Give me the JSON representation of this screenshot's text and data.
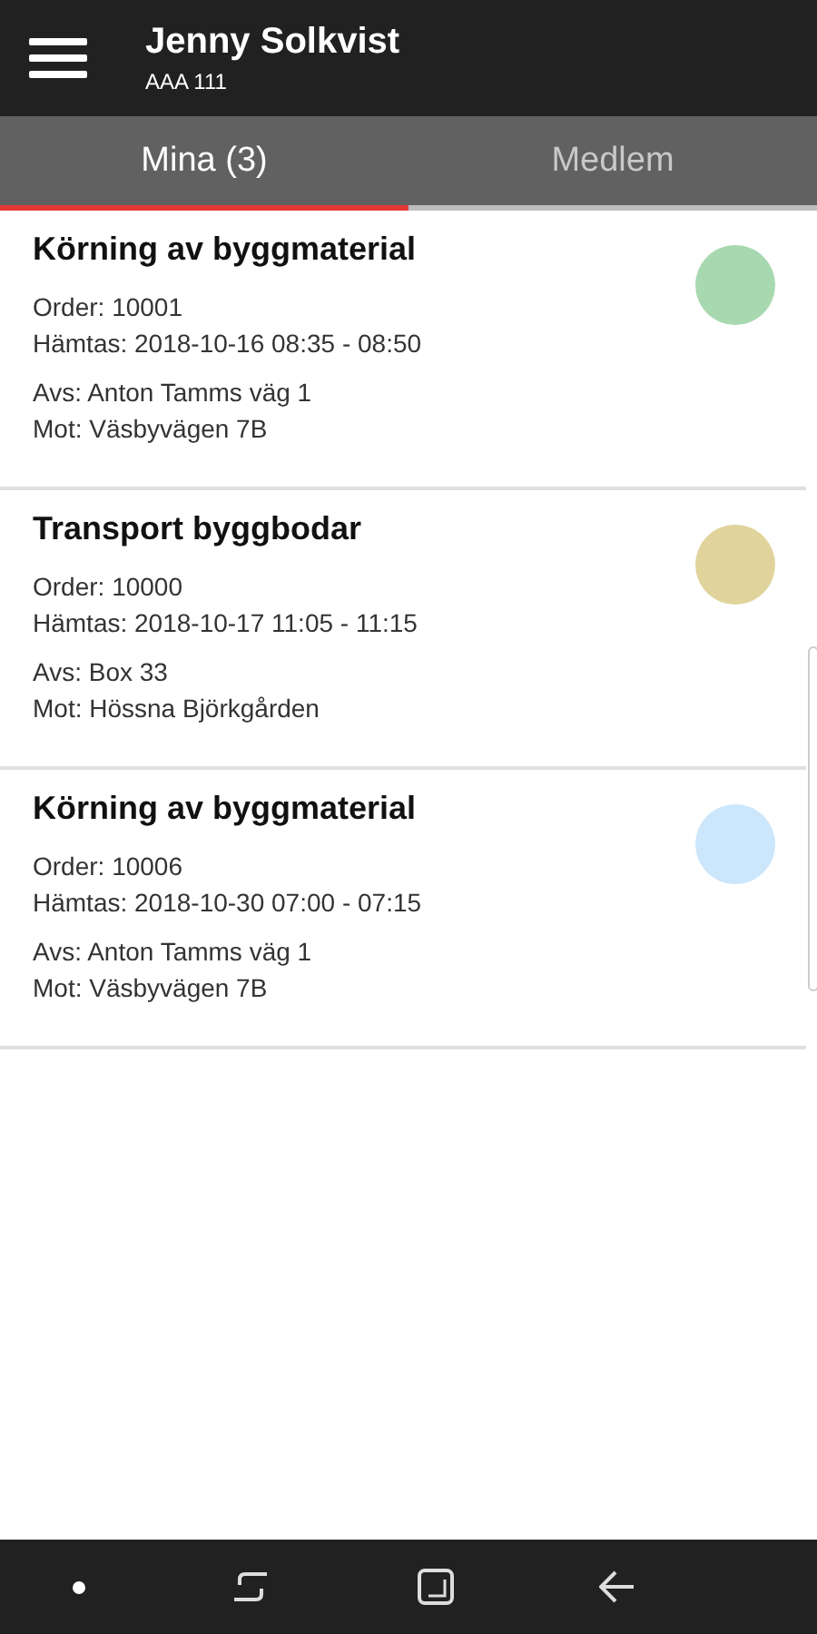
{
  "header": {
    "title": "Jenny Solkvist",
    "subtitle": "AAA 111"
  },
  "tabs": [
    {
      "label": "Mina (3)",
      "selected": true
    },
    {
      "label": "Medlem",
      "selected": false
    }
  ],
  "orders": [
    {
      "title": "Körning av byggmaterial",
      "order": "Order: 10001",
      "pickup": "Hämtas: 2018-10-16 08:35 - 08:50",
      "sender": "Avs: Anton Tamms väg 1",
      "recipient": "Mot: Väsbyvägen 7B",
      "color": "#a8d8b0"
    },
    {
      "title": "Transport byggbodar",
      "order": "Order: 10000",
      "pickup": "Hämtas: 2018-10-17 11:05 - 11:15",
      "sender": "Avs: Box 33",
      "recipient": "Mot: Hössna Björkgården",
      "color": "#e0d49c"
    },
    {
      "title": "Körning av byggmaterial",
      "order": "Order: 10006",
      "pickup": "Hämtas: 2018-10-30 07:00 - 07:15",
      "sender": "Avs: Anton Tamms väg 1",
      "recipient": "Mot: Väsbyvägen 7B",
      "color": "#cce6fb"
    }
  ]
}
